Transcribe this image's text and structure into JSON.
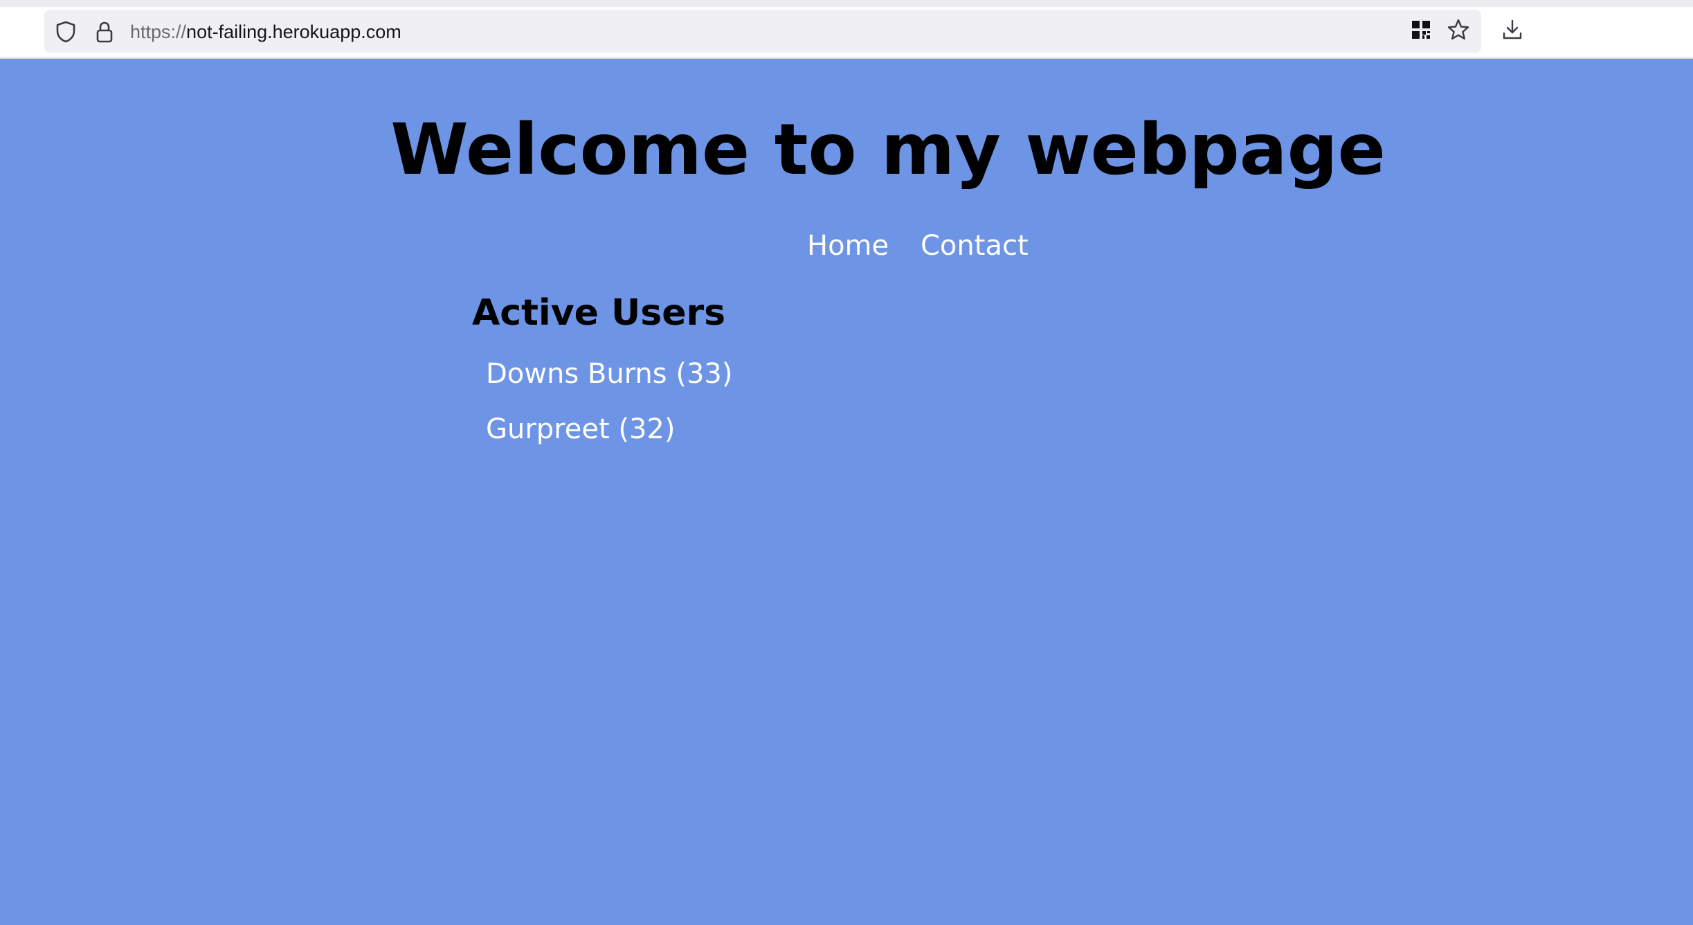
{
  "browser": {
    "url_scheme": "https://",
    "url_host": "not-failing.herokuapp.com",
    "icons": {
      "tracking_protection": "shield-icon",
      "connection": "lock-icon",
      "extension": "qr-code-icon",
      "bookmark": "star-icon",
      "downloads": "download-icon"
    }
  },
  "page": {
    "background_color": "#6d94e5",
    "title": "Welcome to my webpage",
    "nav": {
      "home_label": "Home",
      "contact_label": "Contact"
    },
    "active_users": {
      "heading": "Active Users",
      "users": [
        {
          "label": "Downs Burns (33)"
        },
        {
          "label": "Gurpreet (32)"
        }
      ]
    }
  }
}
